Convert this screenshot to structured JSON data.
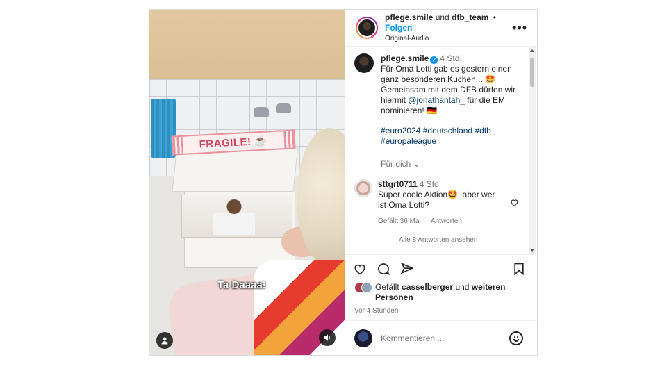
{
  "video": {
    "fragile_label": "FRAGILE! ☕",
    "caption": "Ta Daaaa!"
  },
  "header": {
    "user1": "pflege.smile",
    "and": "und",
    "user2": "dfb_team",
    "separator": "•",
    "follow": "Folgen",
    "audio": "Original-Audio",
    "more": "•••"
  },
  "post": {
    "username": "pflege.smile",
    "verified_icon": "✓",
    "time": "4 Std.",
    "text_1": "Für Oma Lotti gab es gestern einen ganz besonderen Kuchen... 🤩 Gemeinsam mit dem DFB dürfen wir hiermit",
    "mention": "@jonathantah_",
    "text_2": "für die EM nominieren! 🇩🇪",
    "hashtags": "#euro2024 #deutschland #dfb #europaleague",
    "see_translation": "Für dich"
  },
  "comment": {
    "username": "sttgrt0711",
    "time": "4 Std.",
    "text": "Super coole Aktion🤩, aber wer ist Oma Lotti?",
    "likes": "Gefällt 36 Mal",
    "reply": "Antworten",
    "view_replies": "Alle 8 Antworten ansehen"
  },
  "likes": {
    "prefix": "Gefällt",
    "user": "casselberger",
    "and": "und",
    "others": "weiteren Personen"
  },
  "timestamp": "Vor 4 Stunden",
  "comment_box": {
    "placeholder": "Kommentieren ..."
  },
  "colors": {
    "accent": "#0095f6",
    "link": "#00376b",
    "muted": "#737373"
  },
  "icons": {
    "heart": "heart-icon",
    "comment": "comment-icon",
    "share": "share-icon",
    "save": "bookmark-icon",
    "emoji": "emoji-icon",
    "mute": "speaker-icon",
    "tagged": "person-icon"
  }
}
